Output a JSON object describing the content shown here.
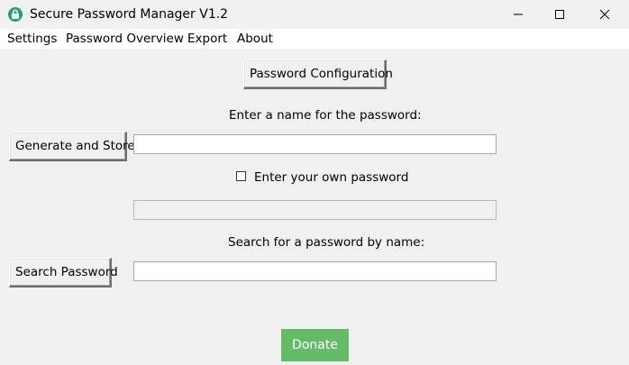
{
  "window": {
    "title": "Secure Password Manager V1.2",
    "icon": "lock-icon",
    "controls": [
      "minimize-icon",
      "maximize-icon",
      "close-icon"
    ]
  },
  "menu": {
    "settings": "Settings",
    "password_overview": "Password Overview",
    "export": "Export",
    "about": "About"
  },
  "main": {
    "config_button": "Password Configuration",
    "name_label": "Enter a name for the password:",
    "generate_button": "Generate and Store",
    "name_input_value": "",
    "own_password_checkbox_label": "Enter your own password",
    "own_password_checked": false,
    "own_password_input_value": "",
    "search_label": "Search for a password by name:",
    "search_button": "Search Password",
    "search_input_value": "",
    "donate_button": "Donate"
  },
  "colors": {
    "background": "#f0f0f0",
    "menubar": "#ffffff",
    "donate": "#66bb6a",
    "app_icon": "#1fa37a"
  }
}
